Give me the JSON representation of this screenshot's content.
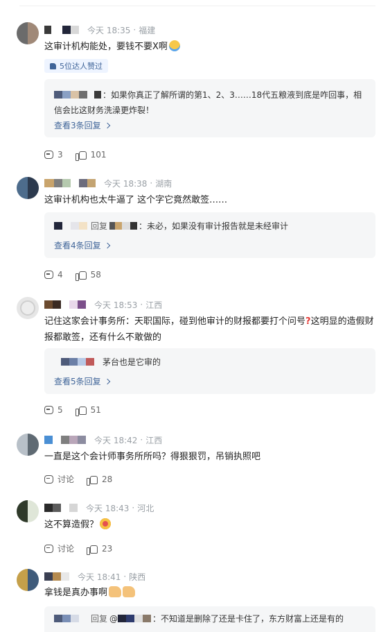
{
  "comments": [
    {
      "time": "今天 18:35",
      "location": "福建",
      "text": "这审计机构能处，要钱不要X啊",
      "badge": "5位达人赞过",
      "reply": {
        "text": "：如果你真正了解所谓的第1、2、3……18代五粮液到底是咋回事，相信会比这财务洗澡更炸裂！",
        "more": "查看3条回复"
      },
      "comment_count": "3",
      "like_count": "101"
    },
    {
      "time": "今天 18:38",
      "location": "湖南",
      "text": "这审计机构也太牛逼了 这个字它竟然敢签……",
      "reply": {
        "keyword": "回复",
        "text": "：未必，如果没有审计报告就是未经审计",
        "more": "查看4条回复"
      },
      "comment_count": "4",
      "like_count": "58"
    },
    {
      "time": "今天 18:53",
      "location": "江西",
      "text_1": "记住这家会计事务所：天职国际，碰到他审计的财报都要打个问号",
      "text_2": "这明显的造假财报都敢签，还有什么不敢做的",
      "reply": {
        "text": "茅台也是它审的",
        "more": "查看5条回复"
      },
      "comment_count": "5",
      "like_count": "51"
    },
    {
      "time": "今天 18:42",
      "location": "江西",
      "text": "一直是这个会计师事务所所吗？得狠狠罚，吊销执照吧",
      "comment_label": "讨论",
      "like_count": "28"
    },
    {
      "time": "今天 18:43",
      "location": "河北",
      "text": "这不算造假？",
      "comment_label": "讨论",
      "like_count": "23"
    },
    {
      "time": "今天 18:41",
      "location": "陕西",
      "text": "拿钱是真办事啊",
      "reply": {
        "keyword": "回复",
        "at": "@",
        "text": "：不知道是删除了还是卡住了，东方财富上还是有的"
      }
    }
  ],
  "separator": "·"
}
